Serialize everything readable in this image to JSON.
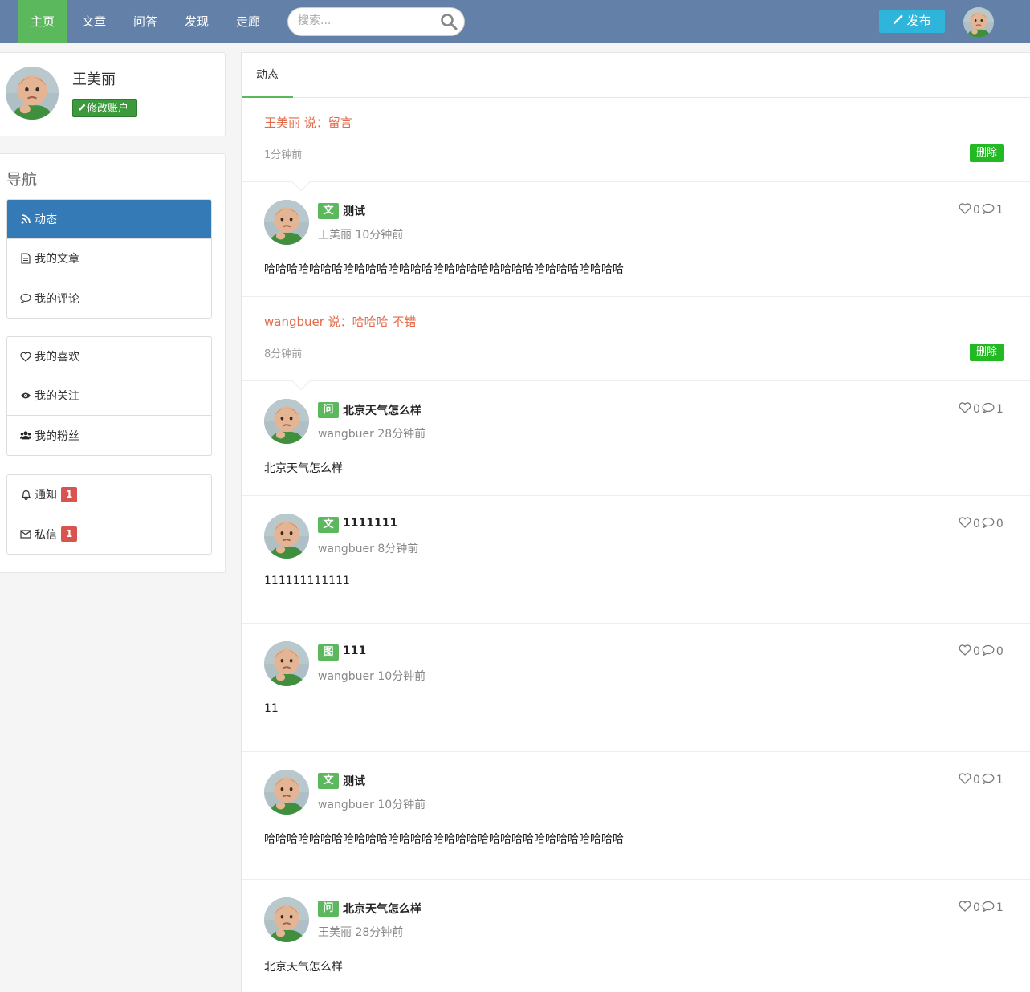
{
  "nav": {
    "items": [
      {
        "label": "主页"
      },
      {
        "label": "文章"
      },
      {
        "label": "问答"
      },
      {
        "label": "发现"
      },
      {
        "label": "走廊"
      }
    ],
    "search_placeholder": "搜索...",
    "publish_label": "发布"
  },
  "profile": {
    "name": "王美丽",
    "edit_label": "修改账户"
  },
  "sidebar": {
    "title": "导航",
    "items": [
      {
        "label": "动态",
        "icon": "rss-icon"
      },
      {
        "label": "我的文章",
        "icon": "document-icon"
      },
      {
        "label": "我的评论",
        "icon": "comment-icon"
      },
      {
        "label": "我的喜欢",
        "icon": "heart-icon"
      },
      {
        "label": "我的关注",
        "icon": "eye-icon"
      },
      {
        "label": "我的粉丝",
        "icon": "users-icon"
      },
      {
        "label": "通知",
        "icon": "bell-icon",
        "badge": "1"
      },
      {
        "label": "私信",
        "icon": "envelope-icon",
        "badge": "1"
      }
    ]
  },
  "feed": {
    "tab": "动态",
    "delete_label": "删除",
    "messages": [
      {
        "text": "王美丽 说：留言",
        "time": "1分钟前"
      },
      {
        "text": "wangbuer 说：哈哈哈  不错",
        "time": "8分钟前"
      }
    ],
    "posts": [
      {
        "tag": "文",
        "title": "测试",
        "meta": "王美丽 10分钟前",
        "likes": "0",
        "comments": "1",
        "content": "哈哈哈哈哈哈哈哈哈哈哈哈哈哈哈哈哈哈哈哈哈哈哈哈哈哈哈哈哈哈哈哈"
      },
      {
        "tag": "问",
        "title": "北京天气怎么样",
        "meta": "wangbuer 28分钟前",
        "likes": "0",
        "comments": "1",
        "content": "北京天气怎么样"
      },
      {
        "tag": "文",
        "title": "1111111",
        "meta": "wangbuer  8分钟前",
        "likes": "0",
        "comments": "0",
        "content": "111111111111"
      },
      {
        "tag": "图",
        "title": "111",
        "meta": "wangbuer  10分钟前",
        "likes": "0",
        "comments": "0",
        "content": "11"
      },
      {
        "tag": "文",
        "title": "测试",
        "meta": "wangbuer  10分钟前",
        "likes": "0",
        "comments": "1",
        "content": "哈哈哈哈哈哈哈哈哈哈哈哈哈哈哈哈哈哈哈哈哈哈哈哈哈哈哈哈哈哈哈哈"
      },
      {
        "tag": "问",
        "title": "北京天气怎么样",
        "meta": "王美丽  28分钟前",
        "likes": "0",
        "comments": "1",
        "content": "北京天气怎么样"
      }
    ]
  },
  "colors": {
    "nav_bg": "#6280a8",
    "nav_active": "#5cb85c",
    "publish": "#2fb5db",
    "sidebar_active": "#337ab7",
    "message_text": "#e36a4a",
    "delete_button": "#22b922",
    "badge": "#d9534f",
    "tag": "#5cb85c"
  }
}
